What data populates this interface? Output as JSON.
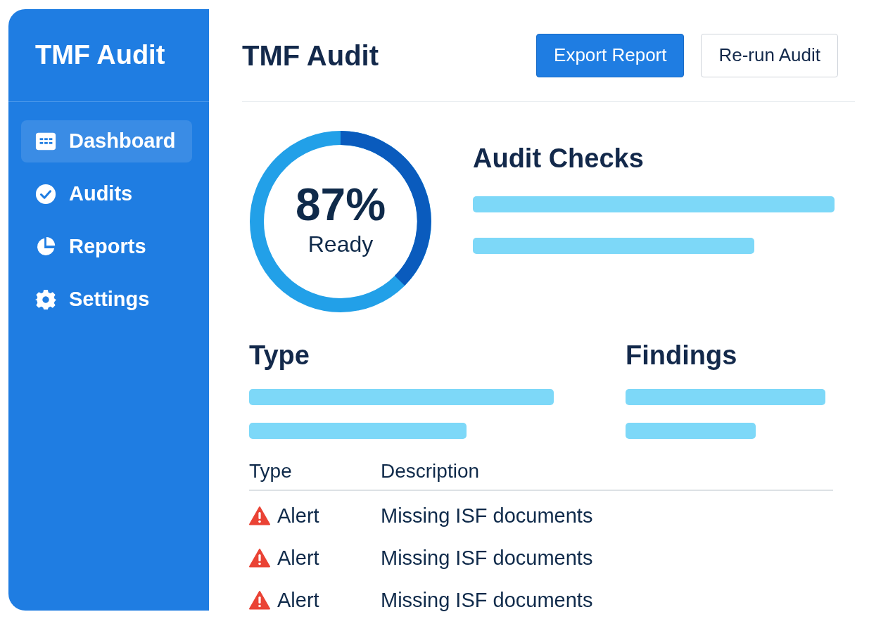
{
  "sidebar": {
    "title": "TMF Audit",
    "items": [
      {
        "label": "Dashboard",
        "selected": true
      },
      {
        "label": "Audits",
        "selected": false
      },
      {
        "label": "Reports",
        "selected": false
      },
      {
        "label": "Settings",
        "selected": false
      }
    ]
  },
  "header": {
    "title": "TMF Audit",
    "buttons": [
      {
        "label": "Export Report",
        "kind": "primary"
      },
      {
        "label": "Re-run Audit",
        "kind": "outline"
      }
    ]
  },
  "readiness": {
    "value": "87%",
    "caption": "Ready"
  },
  "audit_checks": {
    "title": "Audit Checks"
  },
  "type_section": {
    "title": "Type"
  },
  "findings_section": {
    "title": "Findings"
  },
  "table": {
    "columns": [
      "Type",
      "Description"
    ],
    "rows": [
      {
        "kind": "alert",
        "type": "Alert",
        "description": "Missing ISF documents"
      },
      {
        "kind": "alert",
        "type": "Alert",
        "description": "Missing ISF documents"
      },
      {
        "kind": "alert",
        "type": "Alert",
        "description": "Missing ISF documents"
      }
    ]
  }
}
